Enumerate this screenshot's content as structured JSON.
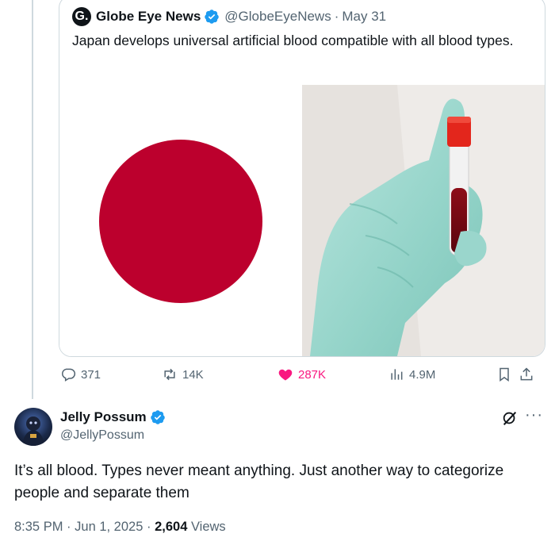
{
  "quoted_tweet": {
    "logo_letter": "G.",
    "author_name": "Globe Eye News",
    "handle": "@GlobeEyeNews",
    "separator": "·",
    "date": "May 31",
    "text": "Japan develops universal artificial blood compatible with all blood types.",
    "media": {
      "left_image": "japan-flag",
      "right_image": "gloved-hand-holding-blood-vial",
      "flag_color": "#bc002d"
    }
  },
  "actions": {
    "replies": "371",
    "reposts": "14K",
    "likes": "287K",
    "views": "4.9M",
    "liked_color": "#f91880"
  },
  "reply_tweet": {
    "author_name": "Jelly Possum",
    "handle": "@JellyPossum",
    "text": "It’s all blood. Types never meant anything. Just another way to categorize people and separate them",
    "time": "8:35 PM",
    "date": "Jun 1, 2025",
    "views_count": "2,604",
    "views_label": "Views",
    "more_label": "···"
  },
  "colors": {
    "verified_blue": "#1d9bf0",
    "secondary_text": "#536471"
  }
}
